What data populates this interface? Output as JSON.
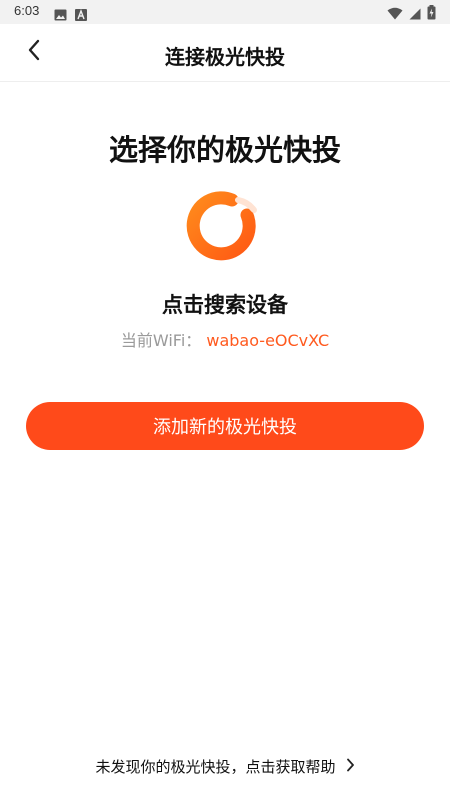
{
  "status_bar": {
    "time": "6:03",
    "left_icons": [
      "image-icon",
      "a-badge-icon"
    ],
    "right_icons": [
      "wifi-icon",
      "cell-signal-icon",
      "battery-charging-icon"
    ]
  },
  "header": {
    "title": "连接极光快投",
    "back_icon": "chevron-left-icon"
  },
  "main": {
    "title": "选择你的极光快投",
    "logo_icon": "refresh-ring-logo",
    "search_prompt": "点击搜索设备",
    "wifi_label": "当前WiFi：",
    "wifi_name": "wabao-eOCvXC"
  },
  "add_button": {
    "label": "添加新的极光快投"
  },
  "help": {
    "text": "未发现你的极光快投，点击获取帮助",
    "icon": "chevron-right-icon"
  },
  "colors": {
    "accent": "#ff4a1a",
    "accent_text": "#ff5a1f",
    "muted_text": "#9a9a9a",
    "status_bar": "#f2f2f2"
  }
}
